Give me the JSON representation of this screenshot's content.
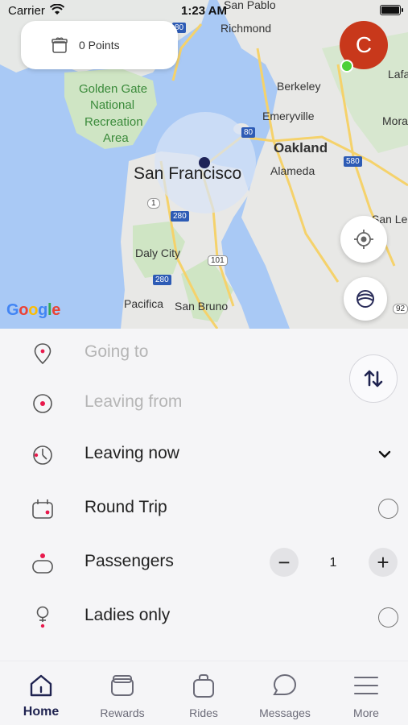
{
  "status_bar": {
    "carrier": "Carrier",
    "time": "1:23 AM"
  },
  "points_card": {
    "label": "0 Points",
    "icon": "gift-icon"
  },
  "avatar": {
    "initial": "C",
    "color": "#c8381b",
    "status_color": "#4cd137"
  },
  "map": {
    "labels": {
      "san_francisco": "San Francisco",
      "oakland": "Oakland",
      "golden_gate": "Golden Gate",
      "national": "National",
      "recreation": "Recreation",
      "area": "Area",
      "berkeley": "Berkeley",
      "emeryville": "Emeryville",
      "alameda": "Alameda",
      "richmond": "Richmond",
      "san_pablo": "San Pablo",
      "daly_city": "Daly City",
      "pacifica": "Pacifica",
      "san_bruno": "San Bruno",
      "lafa": "Lafa",
      "mora": "Mora",
      "san_leandr": "San Leandr",
      "shield_80a": "80",
      "shield_80b": "80",
      "shield_280a": "280",
      "shield_280b": "280",
      "shield_580": "580",
      "shield_1": "1",
      "shield_101": "101",
      "shield_92": "92"
    },
    "google": {
      "G": "G",
      "o1": "o",
      "o2": "o",
      "g": "g",
      "l": "l",
      "e": "e"
    },
    "locate_icon": "crosshair-icon",
    "layers_icon": "layers-icon"
  },
  "form": {
    "going_to": "Going to",
    "leaving_from": "Leaving from",
    "leaving_now": "Leaving now",
    "round_trip": "Round Trip",
    "passengers": "Passengers",
    "passenger_count": "1",
    "minus": "−",
    "plus": "+",
    "ladies_only": "Ladies only",
    "accent_color": "#e8194c"
  },
  "tabs": [
    {
      "label": "Home",
      "icon": "home-icon",
      "active": true
    },
    {
      "label": "Rewards",
      "icon": "gift-icon",
      "active": false
    },
    {
      "label": "Rides",
      "icon": "bag-icon",
      "active": false
    },
    {
      "label": "Messages",
      "icon": "chat-icon",
      "active": false
    },
    {
      "label": "More",
      "icon": "menu-icon",
      "active": false
    }
  ]
}
